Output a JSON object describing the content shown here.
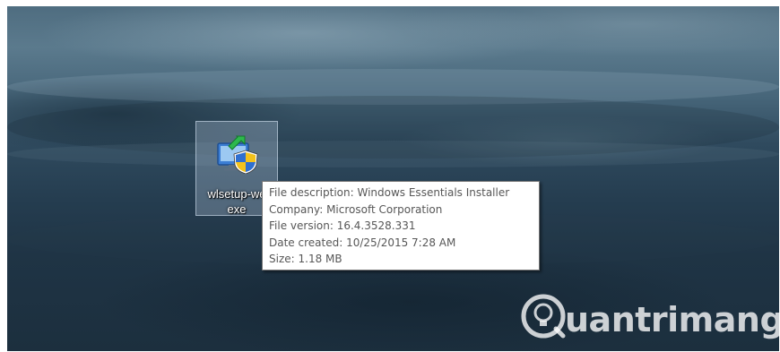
{
  "desktop": {
    "icon": {
      "label_line1": "wlsetup-we",
      "label_line2": "exe",
      "icon_name": "windows-installer-shield-icon"
    },
    "tooltip": {
      "description": "File description: Windows Essentials Installer",
      "company": "Company: Microsoft Corporation",
      "version": "File version: 16.4.3528.331",
      "date_created": "Date created: 10/25/2015 7:28 AM",
      "size": "Size: 1.18 MB"
    }
  },
  "watermark": {
    "text": "uantrimang",
    "logo_icon": "quantrimang-bulb-logo-icon"
  },
  "colors": {
    "tooltip_text": "#575757",
    "tooltip_border": "#767676",
    "selection_fill": "#c8dcf0",
    "arrow_green": "#2db84d",
    "shield_blue": "#2f6fd0",
    "shield_yellow": "#f4c21b"
  }
}
